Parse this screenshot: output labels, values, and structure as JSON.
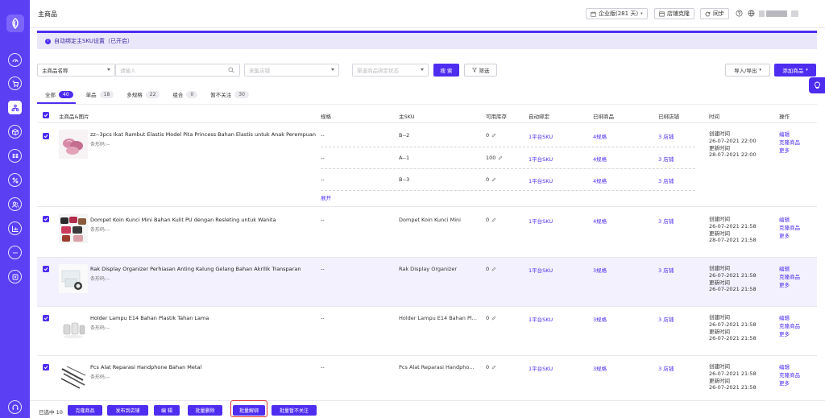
{
  "header": {
    "title": "主商品",
    "plan": "企业版(281 天)",
    "store_clone": "店铺克隆",
    "sync": "同步"
  },
  "notice": {
    "text": "自动绑定主SKU设置（已开启）"
  },
  "filters": {
    "field_select": "主商品名称",
    "search_placeholder": "请输入",
    "store_placeholder": "来集店铺",
    "bind_status_placeholder": "渠道商品绑定状态",
    "search_button": "搜 索",
    "filter_button": "筛选",
    "import_export": "导入/导出",
    "add_product": "添加商品"
  },
  "tabs": [
    {
      "label": "全部",
      "count": "40"
    },
    {
      "label": "单品",
      "count": "18"
    },
    {
      "label": "多规格",
      "count": "22"
    },
    {
      "label": "组合",
      "count": "0"
    },
    {
      "label": "暂不关注",
      "count": "30"
    }
  ],
  "columns": {
    "product": "主商品&图片",
    "spec": "规格",
    "sku": "主SKU",
    "stock": "可用库存",
    "auto_bind": "自动绑定",
    "bound_products": "已绑商品",
    "bound_stores": "已绑店铺",
    "time": "时间",
    "actions": "操作"
  },
  "labels": {
    "barcode": "条形码:--",
    "created": "创建时间",
    "updated": "更新时间",
    "op_edit": "编辑",
    "op_clone": "克隆商品",
    "op_more": "更多",
    "expand": "展开"
  },
  "rows": [
    {
      "name": "zz--3pcs Ikat Rambut Elastis Model Pita Princess Bahan Elastis untuk Anak Perempuan",
      "created": "26-07-2021 22:00",
      "updated": "28-07-2021 22:00",
      "variants": [
        {
          "spec": "--",
          "sku": "B--2",
          "stock": "0",
          "auto": "1平台SKU",
          "bound": "4规格",
          "stores": "3 店铺"
        },
        {
          "spec": "--",
          "sku": "A--1",
          "stock": "100",
          "auto": "1平台SKU",
          "bound": "4规格",
          "stores": "3 店铺"
        },
        {
          "spec": "--",
          "sku": "B--3",
          "stock": "0",
          "auto": "1平台SKU",
          "bound": "4规格",
          "stores": "3 店铺"
        }
      ]
    },
    {
      "name": "Dompet Koin Kunci Mini Bahan Kulit PU dengan Resleting untuk Wanita",
      "spec": "--",
      "sku": "Dompet Koin Kunci Mini",
      "stock": "0",
      "auto": "1平台SKU",
      "bound": "4规格",
      "stores": "3 店铺",
      "created": "26-07-2021 21:58",
      "updated": "28-07-2021 21:58"
    },
    {
      "name": "Rak Display Organizer Perhiasan Anting Kalung Gelang Bahan Akrilik Transparan",
      "spec": "--",
      "sku": "Rak Display Organizer",
      "stock": "0",
      "auto": "1平台SKU",
      "bound": "3规格",
      "stores": "3 店铺",
      "created": "26-07-2021 21:58",
      "updated": "26-07-2021 21:58"
    },
    {
      "name": "Holder Lampu E14 Bahan Plastik Tahan Lama",
      "spec": "--",
      "sku": "Holder Lampu E14 Bahan Pl...",
      "stock": "0",
      "auto": "1平台SKU",
      "bound": "3规格",
      "stores": "3 店铺",
      "created": "26-07-2021 21:58",
      "updated": "26-07-2021 21:58"
    },
    {
      "name": "Pcs Alat Reparasi Handphone Bahan Metal",
      "spec": "--",
      "sku": "Pcs Alat Reparasi Handpho...",
      "stock": "0",
      "auto": "1平台SKU",
      "bound": "3规格",
      "stores": "3 店铺",
      "created": "26-07-2021 21:58",
      "updated": "26-07-2021 21:58"
    }
  ],
  "bottom": {
    "selected": "已选中 10",
    "buttons": [
      "克隆商品",
      "发布到店铺",
      "编 辑",
      "批量删除",
      "批量解绑",
      "批量暂不关注"
    ]
  },
  "colors": {
    "brand": "#4e2df0",
    "sidebar": "#5b3ff3",
    "highlight_box": "#e03030",
    "notice_bg": "#ebe7fb"
  }
}
